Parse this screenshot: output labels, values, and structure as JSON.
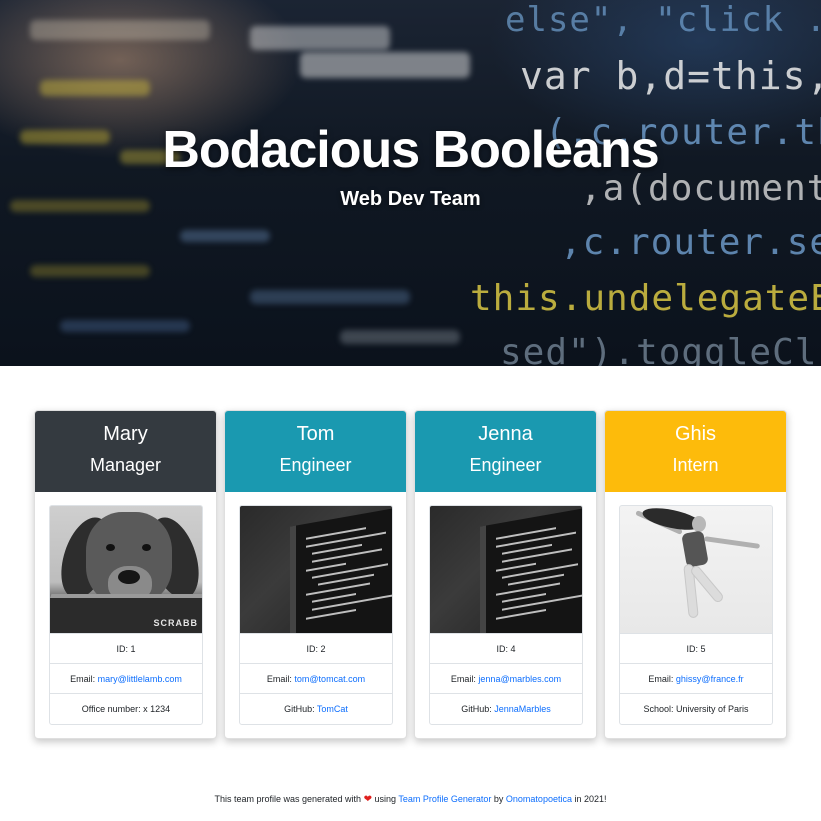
{
  "hero": {
    "title": "Bodacious Booleans",
    "subtitle": "Web Dev Team",
    "background_code_lines": [
      "else\", \"click .c",
      "var b,d=this,e=t",
      "(.c.router.then",
      ",a(document.",
      ",c.router.selec",
      "this.undelegateEve",
      "sed\").toggleCl"
    ]
  },
  "team": [
    {
      "name": "Mary",
      "role": "Manager",
      "header_color": "#343a40",
      "photo_icon": "dog-photo",
      "id_text": "ID: 1",
      "email_label": "Email: ",
      "email": "mary@littlelamb.com",
      "extra_label": "Office number: x 1234",
      "extra_link": ""
    },
    {
      "name": "Tom",
      "role": "Engineer",
      "header_color": "#1a99b0",
      "photo_icon": "laptop-code-photo",
      "id_text": "ID: 2",
      "email_label": "Email: ",
      "email": "tom@tomcat.com",
      "extra_label": "GitHub: ",
      "extra_link": "TomCat"
    },
    {
      "name": "Jenna",
      "role": "Engineer",
      "header_color": "#1a99b0",
      "photo_icon": "laptop-code-photo",
      "id_text": "ID: 4",
      "email_label": "Email: ",
      "email": "jenna@marbles.com",
      "extra_label": "GitHub: ",
      "extra_link": "JennaMarbles"
    },
    {
      "name": "Ghis",
      "role": "Intern",
      "header_color": "#fdbb0b",
      "photo_icon": "jumping-person-photo",
      "id_text": "ID: 5",
      "email_label": "Email: ",
      "email": "ghissy@france.fr",
      "extra_label": "School: University of Paris",
      "extra_link": ""
    }
  ],
  "footer": {
    "prefix": "This team profile was generated with",
    "heart_icon": "heart-icon",
    "middle": "using",
    "generator_link": "Team Profile Generator",
    "by": "by",
    "author_link": "Onomatopoetica",
    "suffix": "in 2021!"
  },
  "colors": {
    "link": "#0d6efd",
    "heart": "#e0201e"
  }
}
